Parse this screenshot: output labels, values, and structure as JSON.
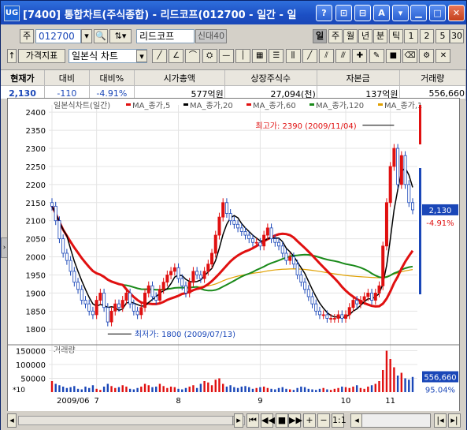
{
  "window": {
    "icon_text": "UG",
    "title": "[7400] 통합차트(주식종합) - 리드코프(012700 - 일간 - 일",
    "btn_help": "?",
    "btn_b": "⊡",
    "btn_c": "⊟",
    "btn_font": "A",
    "btn_min": "▁",
    "btn_max": "□",
    "btn_close": "✕"
  },
  "toolbar1": {
    "type_label": "주",
    "code": "012700",
    "name": "리드코프",
    "badge": "신대40",
    "periods": [
      "일",
      "주",
      "월",
      "년",
      "분",
      "틱",
      "1",
      "2",
      "5",
      "30"
    ]
  },
  "toolbar2": {
    "btn_indicator": "가격지표",
    "chart_type": "일본식 차트"
  },
  "info": {
    "headers": [
      "현재가",
      "대비",
      "대비%",
      "시가총액",
      "상장주식수",
      "자본금",
      "거래량"
    ],
    "values": [
      "2,130",
      "-110",
      "-4.91%",
      "577억원",
      "27,094(천)",
      "137억원",
      "556,660"
    ]
  },
  "chart": {
    "legend_title": "일본식차트(일간)",
    "legend": [
      {
        "name": "MA_종가,5",
        "color": "#e01010"
      },
      {
        "name": "MA_종가,20",
        "color": "#000000"
      },
      {
        "name": "MA_종가,60",
        "color": "#e01010"
      },
      {
        "name": "MA_종가,120",
        "color": "#1a8a1a"
      },
      {
        "name": "MA_종가,1",
        "color": "#e0a000"
      }
    ],
    "high_label": "최고가: 2390 (2009/11/04)",
    "low_label": "최저가: 1800 (2009/07/13)",
    "price_ticks": [
      "2400",
      "2350",
      "2300",
      "2250",
      "2200",
      "2150",
      "2100",
      "2050",
      "2000",
      "1950",
      "1900",
      "1850",
      "1800"
    ],
    "current_price": "2,130",
    "current_change": "-4.91%",
    "volume_title": "거래량",
    "volume_ticks": [
      "150000",
      "100000",
      "50000"
    ],
    "volume_unit": "*10",
    "volume_value": "556,660",
    "volume_pct": "95.04%",
    "x_labels": [
      "2009/06",
      "7",
      "8",
      "9",
      "10",
      "11"
    ]
  },
  "chart_data": {
    "type": "candlestick",
    "title": "일본식차트(일간)",
    "ylim": [
      1770,
      2420
    ],
    "x_ticks": [
      "2009/06",
      "7",
      "8",
      "9",
      "10",
      "11"
    ],
    "close": [
      2140,
      2100,
      2050,
      2010,
      1990,
      1960,
      1930,
      1910,
      1880,
      1870,
      1850,
      1840,
      1880,
      1900,
      1860,
      1820,
      1850,
      1870,
      1860,
      1880,
      1900,
      1870,
      1850,
      1840,
      1860,
      1900,
      1920,
      1890,
      1880,
      1910,
      1930,
      1950,
      1960,
      1970,
      1940,
      1920,
      1900,
      1930,
      1960,
      1950,
      1940,
      1960,
      1980,
      2010,
      2060,
      2110,
      2150,
      2120,
      2100,
      2090,
      2080,
      2070,
      2060,
      2050,
      2040,
      2040,
      2030,
      2060,
      2080,
      2050,
      2040,
      2030,
      2010,
      1990,
      2000,
      1980,
      1950,
      1930,
      1910,
      1890,
      1870,
      1850,
      1840,
      1840,
      1830,
      1830,
      1830,
      1840,
      1830,
      1840,
      1860,
      1880,
      1870,
      1880,
      1890,
      1900,
      1880,
      1900,
      1920,
      2030,
      2150,
      2250,
      2300,
      2200,
      2280,
      2200,
      2150,
      2130
    ],
    "volume": [
      40000,
      30000,
      25000,
      20000,
      15000,
      18000,
      22000,
      12000,
      10000,
      20000,
      15000,
      25000,
      12000,
      8000,
      20000,
      30000,
      22000,
      15000,
      18000,
      25000,
      20000,
      12000,
      10000,
      15000,
      20000,
      30000,
      25000,
      18000,
      20000,
      30000,
      22000,
      15000,
      20000,
      18000,
      12000,
      10000,
      15000,
      20000,
      25000,
      15000,
      30000,
      40000,
      35000,
      25000,
      45000,
      50000,
      30000,
      20000,
      25000,
      18000,
      15000,
      20000,
      22000,
      18000,
      12000,
      15000,
      18000,
      20000,
      15000,
      12000,
      10000,
      15000,
      18000,
      12000,
      10000,
      8000,
      15000,
      20000,
      18000,
      12000,
      10000,
      8000,
      12000,
      15000,
      10000,
      8000,
      12000,
      15000,
      20000,
      18000,
      15000,
      20000,
      25000,
      15000,
      12000,
      20000,
      25000,
      30000,
      40000,
      80000,
      150000,
      120000,
      90000,
      60000,
      70000,
      50000,
      45000,
      55000
    ]
  }
}
